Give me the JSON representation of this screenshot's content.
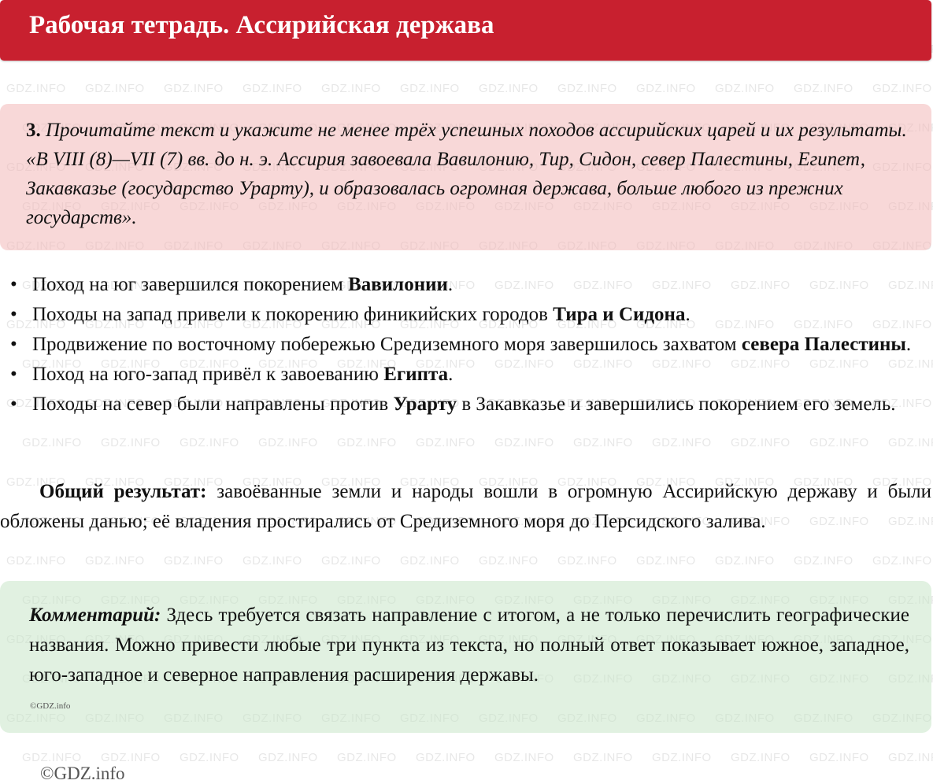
{
  "header": {
    "title": "Рабочая тетрадь. Ассирийская держава"
  },
  "task": {
    "number": "3.",
    "text": "Прочитайте текст и укажите не менее трёх успешных походов ассирийских царей и их результаты. «В VIII (8)—VII (7) вв. до н. э. Ассирия завоевала Вавилонию, Тир, Сидон, север Палестины, Египет, Закавказье (государство Урарту), и образовалась огромная держава, больше любого из прежних государств»."
  },
  "answers": [
    {
      "before": "Поход на юг завершился покорением ",
      "bold": "Вавилонии",
      "after": "."
    },
    {
      "before": "Походы на запад привели к покорению финикийских городов ",
      "bold": "Тира и Сидона",
      "after": "."
    },
    {
      "before": "Продвижение по восточному побережью Средиземного моря завершилось захватом ",
      "bold": "севера Палестины",
      "after": "."
    },
    {
      "before": "Поход на юго-запад привёл к завоеванию ",
      "bold": "Египта",
      "after": "."
    },
    {
      "before": "Походы на север были направлены против ",
      "bold": "Урарту",
      "after": " в Закавказье и завершились покорением его земель."
    }
  ],
  "summary": {
    "label": "Общий результат:",
    "text": " завоёванные земли и народы вошли в огромную Ассирийскую державу и были обложены данью; её владения простирались от Средиземного моря до Персидского залива."
  },
  "comment": {
    "label": "Комментарий:",
    "text": " Здесь требуется связать направление с итогом, а не только перечислить географические названия. Можно привести любые три пункта из текста, но полный ответ показывает южное, западное, юго-западное и северное направления расширения державы."
  },
  "watermark": {
    "text": "GDZ.INFO"
  },
  "small_copyright": "©GDZ.info",
  "footer_copyright": "©GDZ.info"
}
